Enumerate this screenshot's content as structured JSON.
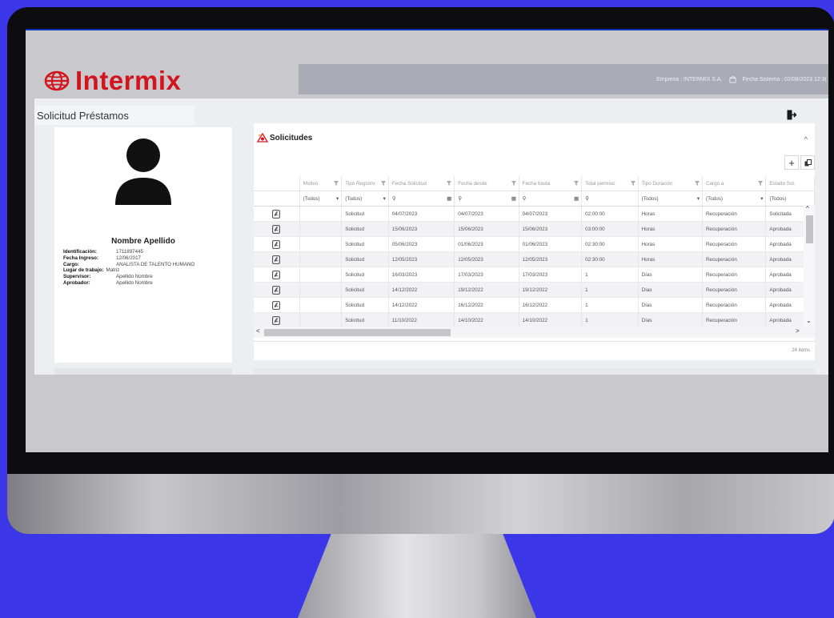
{
  "colors": {
    "background": "#3b37e8",
    "brand_red": "#d4141c",
    "topbar": "#a9acb6"
  },
  "brand": {
    "name": "Intermix"
  },
  "topbar": {
    "empresa": "Empresa : INTERMIX S.A.",
    "fecha_sistema": "Fecha Sistema : 02/08/2023 12:3("
  },
  "page": {
    "title": "Solicitud Préstamos"
  },
  "profile": {
    "name": "Nombre Apellido",
    "fields": [
      {
        "label": "Identificación:",
        "value": "1711897445"
      },
      {
        "label": "Fecha Ingreso:",
        "value": "12/06/2017"
      },
      {
        "label": "Cargo:",
        "value": "ANALISTA DE TALENTO HUMANO"
      },
      {
        "label": "Lugar de trabajo:",
        "value": "Matriz"
      },
      {
        "label": "Supervisor:",
        "value": "Apellido Nombre"
      },
      {
        "label": "Aprobador:",
        "value": "Apellido Nombre"
      }
    ]
  },
  "panel": {
    "title": "Solicitudes",
    "add_label": "+",
    "items_count": "24 items"
  },
  "grid": {
    "columns": [
      "",
      "Motivo",
      "Tipo Registro",
      "Fecha Solicitud",
      "Fecha desde",
      "Fecha hasta",
      "Total permiso",
      "Tipo Duración",
      "Cargo a",
      "Estado Sol."
    ],
    "filters": [
      "",
      "(Todos)",
      "(Todos)",
      "",
      "",
      "",
      "",
      "(Todos)",
      "(Todos)",
      "(Todos)"
    ],
    "rows": [
      [
        "",
        "",
        "Solicitud",
        "04/07/2023",
        "04/07/2023",
        "04/07/2023",
        "02:00:00",
        "Horas",
        "Recuperación",
        "Solicitada"
      ],
      [
        "",
        "",
        "Solicitud",
        "15/06/2023",
        "15/06/2023",
        "15/06/2023",
        "03:00:00",
        "Horas",
        "Recuperación",
        "Aprobada"
      ],
      [
        "",
        "",
        "Solicitud",
        "05/06/2023",
        "01/06/2023",
        "01/06/2023",
        "02:30:00",
        "Horas",
        "Recuperación",
        "Aprobada"
      ],
      [
        "",
        "",
        "Solicitud",
        "12/05/2023",
        "12/05/2023",
        "12/05/2023",
        "02:30:00",
        "Horas",
        "Recuperación",
        "Aprobada"
      ],
      [
        "",
        "",
        "Solicitud",
        "16/03/2023",
        "17/03/2023",
        "17/03/2023",
        "1",
        "Días",
        "Recuperación",
        "Aprobada"
      ],
      [
        "",
        "",
        "Solicitud",
        "14/12/2022",
        "19/12/2022",
        "19/12/2022",
        "1",
        "Días",
        "Recuperación",
        "Aprobada"
      ],
      [
        "",
        "",
        "Solicitud",
        "14/12/2022",
        "16/12/2022",
        "16/12/2022",
        "1",
        "Días",
        "Recuperación",
        "Aprobada"
      ],
      [
        "",
        "",
        "Solicitud",
        "11/10/2022",
        "14/10/2022",
        "14/10/2022",
        "1",
        "Días",
        "Recuperación",
        "Aprobada"
      ]
    ]
  }
}
